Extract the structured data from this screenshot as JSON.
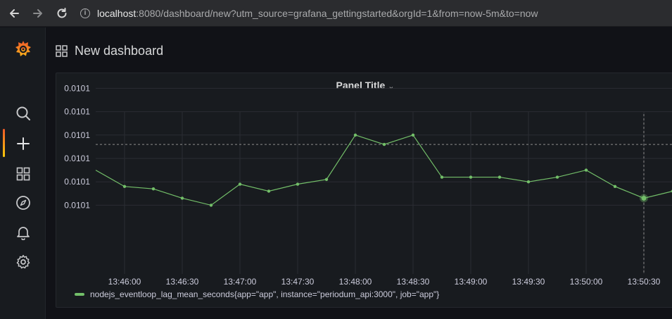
{
  "browser": {
    "url_host": "localhost",
    "url_rest": ":8080/dashboard/new?utm_source=grafana_gettingstarted&orgId=1&from=now-5m&to=now",
    "back_icon": "arrow-left-icon",
    "forward_icon": "arrow-right-icon",
    "reload_icon": "reload-icon",
    "info_icon": "info-icon"
  },
  "sidebar": {
    "items": [
      {
        "name": "grafana-logo",
        "icon": "grafana-logo"
      },
      {
        "name": "search",
        "icon": "search-icon"
      },
      {
        "name": "create",
        "icon": "plus-icon",
        "active": true
      },
      {
        "name": "dashboards",
        "icon": "grid-icon"
      },
      {
        "name": "explore",
        "icon": "compass-icon"
      },
      {
        "name": "alerting",
        "icon": "bell-icon"
      },
      {
        "name": "configuration",
        "icon": "gear-icon"
      }
    ]
  },
  "header": {
    "title": "New dashboard",
    "icon": "dashboard-grid-icon"
  },
  "panel": {
    "title": "Panel Title",
    "menu_icon": "chevron-down-icon"
  },
  "chart_data": {
    "type": "line",
    "title": "Panel Title",
    "x_ticks": [
      "13:46:00",
      "13:46:30",
      "13:47:00",
      "13:47:30",
      "13:48:00",
      "13:48:30",
      "13:49:00",
      "13:49:30",
      "13:50:00",
      "13:50:30"
    ],
    "y_ticks": [
      "0.0101",
      "0.0101",
      "0.0101",
      "0.0101",
      "0.0101",
      "0.0101"
    ],
    "x_range": [
      "13:45:45",
      "13:50:45"
    ],
    "series": [
      {
        "name": "nodejs_eventloop_lag_mean_seconds{app=\"app\", instance=\"periodum_api:3000\", job=\"app\"}",
        "color": "#73bf69",
        "x_seconds_offset": [
          0,
          15,
          30,
          45,
          60,
          75,
          90,
          105,
          120,
          135,
          150,
          165,
          180,
          195,
          210,
          225,
          240,
          255,
          270,
          285,
          300
        ],
        "y_tick_units": [
          4.5,
          3.8,
          3.7,
          3.3,
          3.0,
          3.9,
          3.6,
          3.9,
          4.1,
          6.0,
          5.6,
          6.0,
          4.2,
          4.2,
          4.2,
          4.0,
          4.2,
          4.5,
          3.8,
          3.3,
          3.6
        ]
      }
    ],
    "grid": true,
    "legend": "bottom-left",
    "crosshair_x": "13:50:30"
  }
}
